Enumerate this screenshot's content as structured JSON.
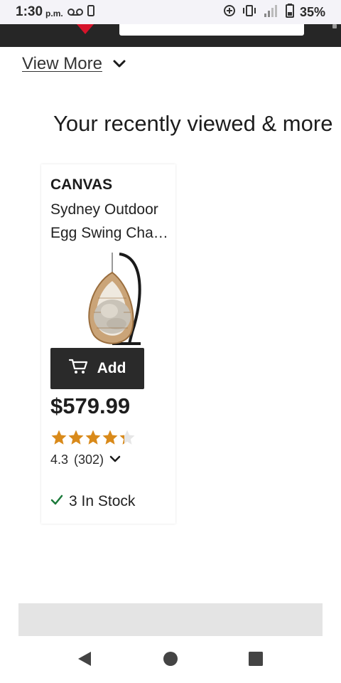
{
  "status_bar": {
    "time": "1:30",
    "ampm": "p.m.",
    "battery_pct": "35%",
    "icons": [
      "voicemail-icon",
      "phone-icon",
      "data-saver-icon",
      "vibrate-icon",
      "signal-icon",
      "battery-icon"
    ]
  },
  "header": {
    "logo_icon": "brand-logo-icon",
    "logo_color": "#d6132a",
    "background": "#262626"
  },
  "view_more": {
    "label": "View More"
  },
  "section": {
    "title": "Your recently viewed & more"
  },
  "product": {
    "brand": "CANVAS",
    "name": "Sydney Outdoor Egg Swing Cha…",
    "add_label": "Add",
    "price": "$579.99",
    "rating": "4.3",
    "reviews": "(302)",
    "rating_fraction": 0.86,
    "star_color": "#d98a1a",
    "stock": "3 In Stock",
    "stock_check_color": "#1b7a3a"
  }
}
